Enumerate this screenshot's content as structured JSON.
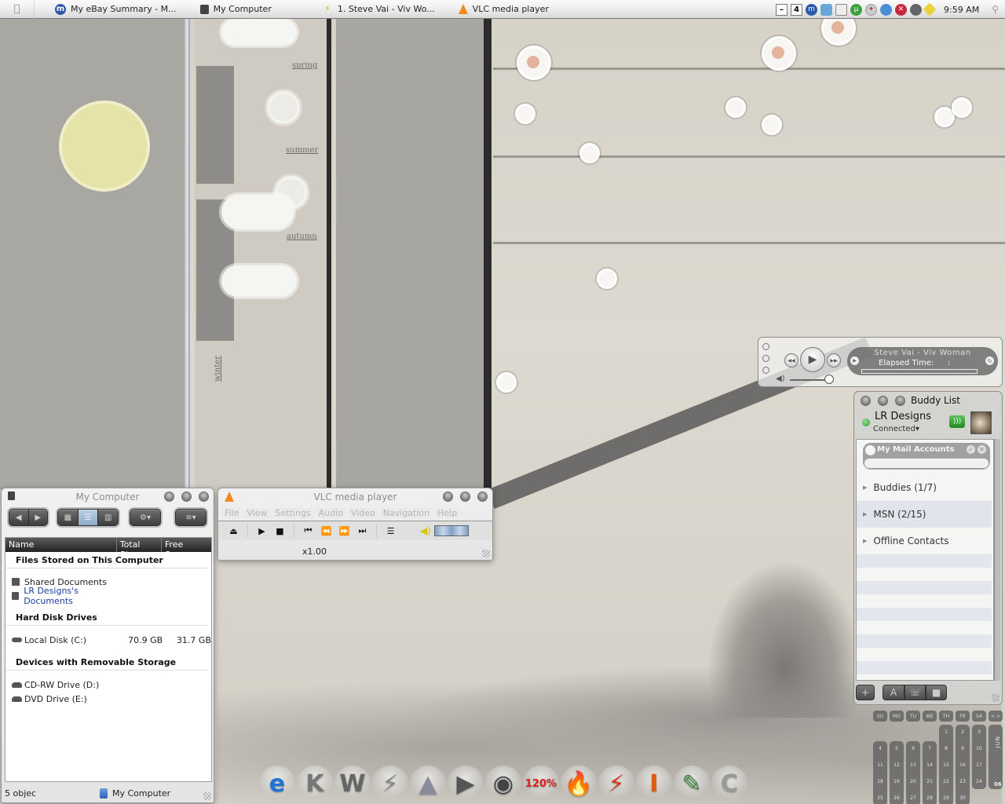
{
  "menubar": {
    "apple_icon": "apple-icon",
    "tasks": [
      {
        "label": "My eBay Summary - M...",
        "icon": "ebay-browser-icon"
      },
      {
        "label": "My Computer",
        "icon": "computer-icon"
      },
      {
        "label": "1. Steve Vai - Viv Wo...",
        "icon": "winamp-icon"
      },
      {
        "label": "VLC media player",
        "icon": "vlc-cone-icon"
      }
    ],
    "tray": {
      "minimize_glyph": "–",
      "desktop_number": "4",
      "icons": [
        "maxthon-icon",
        "network-icon",
        "display-icon",
        "utorrent-icon",
        "compass-icon",
        "messenger-icon",
        "security-shield-icon",
        "webcam-icon",
        "pencil-icon"
      ],
      "clock": "9:59 AM",
      "search_icon": "spotlight-icon"
    }
  },
  "wallpaper": {
    "season_labels": [
      "spring",
      "summer",
      "autumn",
      "winter"
    ]
  },
  "my_computer": {
    "title": "My Computer",
    "toolbar": {
      "back": "◀",
      "forward": "▶",
      "views": [
        "icons-view",
        "list-view",
        "columns-view"
      ],
      "active_view": "list-view",
      "action_menu": "gear-menu",
      "arrange_menu": "arrange-menu"
    },
    "columns": [
      "Name",
      "Total Size",
      "Free Space"
    ],
    "groups": [
      {
        "title": "Files Stored on This Computer",
        "items": [
          {
            "name": "Shared Documents",
            "total": "",
            "free": "",
            "icon": "folder-icon",
            "link": false
          },
          {
            "name": "LR Designs's Documents",
            "total": "",
            "free": "",
            "icon": "folder-icon",
            "link": true
          }
        ]
      },
      {
        "title": "Hard Disk Drives",
        "items": [
          {
            "name": "Local Disk (C:)",
            "total": "70.9 GB",
            "free": "31.7 GB",
            "icon": "hard-disk-icon",
            "link": false
          }
        ]
      },
      {
        "title": "Devices with Removable Storage",
        "items": [
          {
            "name": "CD-RW Drive (D:)",
            "total": "",
            "free": "",
            "icon": "cd-drive-icon",
            "link": false
          },
          {
            "name": "DVD Drive (E:)",
            "total": "",
            "free": "",
            "icon": "dvd-drive-icon",
            "link": false
          }
        ]
      }
    ],
    "status_left": "5 objec",
    "status_center": "My Computer"
  },
  "vlc": {
    "title": "VLC media player",
    "menu": [
      "File",
      "View",
      "Settings",
      "Audio",
      "Video",
      "Navigation",
      "Help"
    ],
    "controls": {
      "eject": "⏏",
      "play": "▶",
      "stop": "■",
      "prev": "⏮",
      "rewind": "⏪",
      "forward": "⏩",
      "next": "⏭",
      "playlist": "☰",
      "volume": "🔈"
    },
    "speed": "x1.00"
  },
  "mini_player": {
    "track": "Steve Vai - Viv Woman",
    "elapsed_label": "Elapsed Time:",
    "elapsed_value": ":",
    "progress": 0,
    "volume": 0.9,
    "rewind": "◀◀",
    "play": "▶",
    "forward": "▶▶"
  },
  "buddy_list": {
    "title": "Buddy List",
    "user": "LR Designs",
    "status": "Connected",
    "status_color": "#2a9a2a",
    "mail_accounts": "My Mail Accounts",
    "groups": [
      {
        "label": "Buddies (1/7)"
      },
      {
        "label": "MSN (2/15)"
      },
      {
        "label": "Offline Contacts"
      }
    ],
    "bottom_buttons": {
      "add": "+",
      "font": "A",
      "voice": "☏",
      "video": "■"
    }
  },
  "calendar": {
    "weekdays": [
      "SU",
      "MO",
      "TU",
      "WE",
      "TH",
      "FR",
      "SA"
    ],
    "nav": "< >",
    "month": "JUN",
    "year": "06",
    "weeks": [
      [
        "",
        "",
        "",
        "",
        "1",
        "2",
        "3"
      ],
      [
        "4",
        "5",
        "6",
        "7",
        "8",
        "9",
        "10"
      ],
      [
        "11",
        "12",
        "13",
        "14",
        "15",
        "16",
        "17"
      ],
      [
        "18",
        "19",
        "20",
        "21",
        "22",
        "23",
        "24"
      ],
      [
        "25",
        "26",
        "27",
        "28",
        "29",
        "30",
        ""
      ]
    ]
  },
  "dock": {
    "items": [
      {
        "name": "internet-explorer",
        "glyph": "e",
        "color": "#1d73d6"
      },
      {
        "name": "k-launcher",
        "glyph": "K",
        "color": "#777"
      },
      {
        "name": "w-app",
        "glyph": "W",
        "color": "#666"
      },
      {
        "name": "no-power",
        "glyph": "⚡",
        "color": "#888"
      },
      {
        "name": "vlc",
        "glyph": "▲",
        "color": "#8a8a9a"
      },
      {
        "name": "media-player",
        "glyph": "▶",
        "color": "#555"
      },
      {
        "name": "speaker",
        "glyph": "◉",
        "color": "#444"
      },
      {
        "name": "acrobat",
        "glyph": "120%",
        "color": "#d92323"
      },
      {
        "name": "burner",
        "glyph": "🔥",
        "color": "#e8830f"
      },
      {
        "name": "winamp",
        "glyph": "⚡",
        "color": "#d23b1b"
      },
      {
        "name": "installer-box",
        "glyph": "I",
        "color": "#e05a10"
      },
      {
        "name": "editor",
        "glyph": "✎",
        "color": "#3d8a3d"
      },
      {
        "name": "c-app",
        "glyph": "C",
        "color": "#999"
      }
    ]
  }
}
